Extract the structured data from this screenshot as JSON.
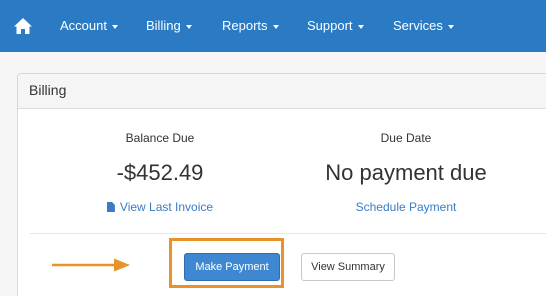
{
  "nav": {
    "items": [
      {
        "label": "Account"
      },
      {
        "label": "Billing"
      },
      {
        "label": "Reports"
      },
      {
        "label": "Support"
      },
      {
        "label": "Services"
      }
    ]
  },
  "panel": {
    "title": "Billing",
    "balance": {
      "label": "Balance Due",
      "value": "-$452.49",
      "link": "View Last Invoice"
    },
    "due_date": {
      "label": "Due Date",
      "value": "No payment due",
      "link": "Schedule Payment"
    },
    "buttons": {
      "make_payment": "Make Payment",
      "view_summary": "View Summary"
    }
  },
  "colors": {
    "navbar": "#2b7bc4",
    "link": "#3a7cc4",
    "primary_button": "#3e88d1",
    "highlight": "#e8932a"
  },
  "icons": {
    "home": "home-icon",
    "invoice": "document-icon",
    "pointer": "arrow-right-icon"
  }
}
